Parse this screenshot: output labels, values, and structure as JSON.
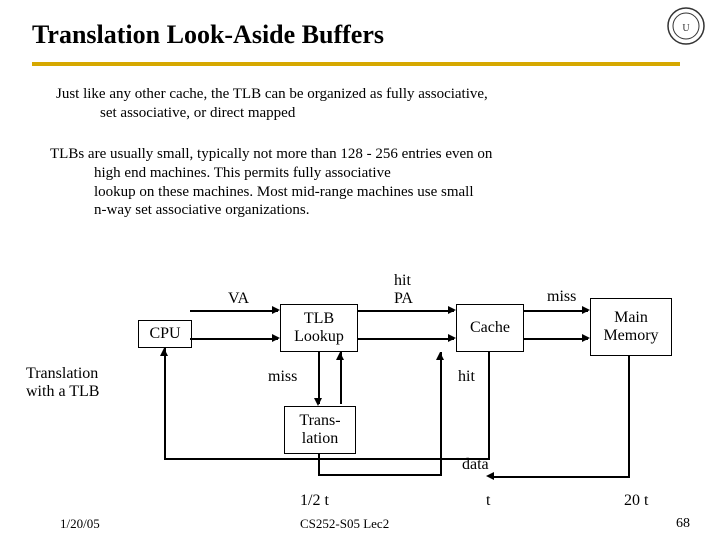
{
  "title": "Translation Look-Aside Buffers",
  "para1_lead": "Just like any other cache, the TLB can be organized as fully associative,",
  "para1_rest": "set associative, or direct mapped",
  "para2_lead": "TLBs are usually small, typically not more than 128 - 256 entries even on",
  "para2_l2": "high end machines.  This permits fully associative",
  "para2_l3": "lookup on these machines.  Most mid-range machines use small",
  "para2_l4": "n-way set associative organizations.",
  "boxes": {
    "cpu": "CPU",
    "tlb": "TLB\nLookup",
    "cache": "Cache",
    "mem": "Main\nMemory",
    "trans": "Trans-\nlation"
  },
  "labels": {
    "va": "VA",
    "hitpa": "hit\nPA",
    "miss": "miss",
    "miss2": "miss",
    "hit": "hit",
    "data": "data",
    "caption": "Translation\nwith a TLB",
    "t12": "1/2 t",
    "t_single": "t",
    "t20": "20 t"
  },
  "footer": {
    "date": "1/20/05",
    "course": "CS252-S05 Lec2",
    "page": "68"
  }
}
